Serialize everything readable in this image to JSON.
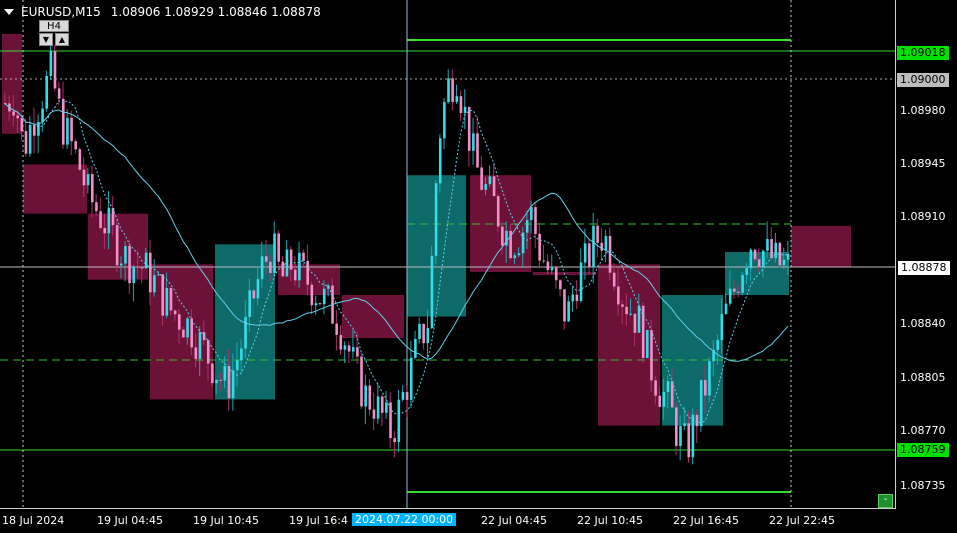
{
  "header": {
    "symbol": "EURUSD,M15",
    "ohlc": "1.08906 1.08929 1.08846 1.08878"
  },
  "timeframe_box": {
    "label": "H4",
    "down": "▼",
    "up": "▲"
  },
  "price_axis": {
    "labels": [
      "1.09018",
      "1.09000",
      "1.08980",
      "1.08945",
      "1.08910",
      "1.08878",
      "1.08840",
      "1.08805",
      "1.08770",
      "1.08759",
      "1.08735"
    ],
    "current_price": "1.08878",
    "level_high": "1.09018",
    "level_low": "1.08759",
    "round_level": "1.09000"
  },
  "time_axis": {
    "labels": [
      "18 Jul 2024",
      "19 Jul 04:45",
      "19 Jul 10:45",
      "19 Jul 16:4",
      "2024.07.22 00:00",
      "22 Jul 04:45",
      "22 Jul 10:45",
      "22 Jul 16:45",
      "22 Jul 22:45"
    ]
  },
  "corner_button": "-",
  "colors": {
    "bull": "#33dde8",
    "bear": "#f090c8",
    "bull_h4": "#0e6a68",
    "bear_h4": "#6c1238",
    "level_line": "#33dd33",
    "ma": "#5fd0e8"
  }
}
